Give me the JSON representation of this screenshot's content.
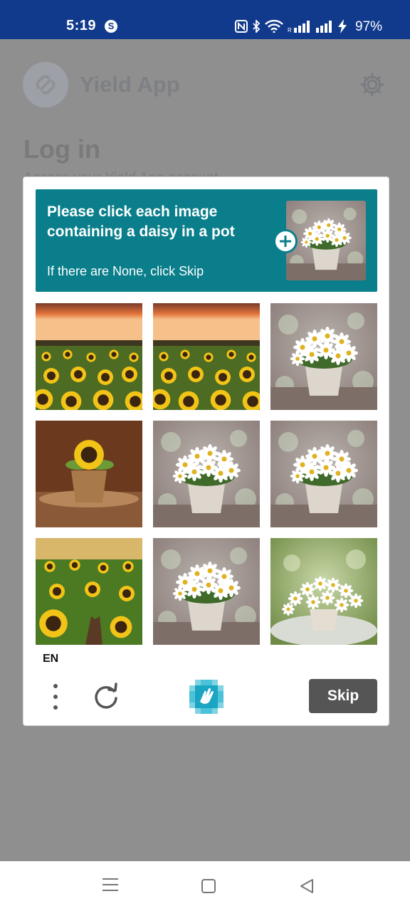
{
  "status_bar": {
    "time": "5:19",
    "app_notification_icon": "S",
    "battery_percent": "97%",
    "icons": [
      "nfc-icon",
      "bluetooth-icon",
      "wifi-icon",
      "signal-icon",
      "signal-icon",
      "charging-icon"
    ],
    "bg_color": "#123a8c"
  },
  "background_app": {
    "app_name": "Yield App",
    "title": "Log in",
    "subtitle": "Access your Yield App account"
  },
  "captcha": {
    "prompt": {
      "text": "Please click each image containing a daisy in a pot",
      "subtext": "If there are None, click Skip",
      "color": "#0a7f8b"
    },
    "tiles": [
      {
        "content": "sunflower-field-sunset"
      },
      {
        "content": "sunflower-field-sunset"
      },
      {
        "content": "daisy-in-pot"
      },
      {
        "content": "sunflower-in-pot"
      },
      {
        "content": "daisy-in-pot"
      },
      {
        "content": "daisy-in-pot"
      },
      {
        "content": "sunflower-field"
      },
      {
        "content": "daisy-in-pot"
      },
      {
        "content": "daisy-in-pot"
      }
    ],
    "language": "EN",
    "skip_label": "Skip"
  }
}
